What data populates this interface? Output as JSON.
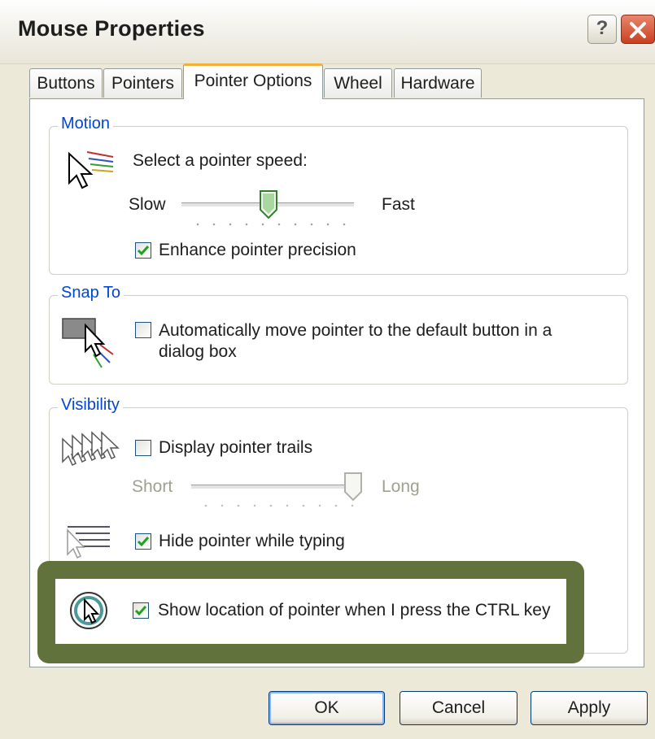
{
  "window": {
    "title": "Mouse Properties",
    "help_label": "?",
    "close_icon": "close-icon"
  },
  "tabs": [
    {
      "label": "Buttons"
    },
    {
      "label": "Pointers"
    },
    {
      "label": "Pointer Options",
      "active": true
    },
    {
      "label": "Wheel"
    },
    {
      "label": "Hardware"
    }
  ],
  "motion": {
    "legend": "Motion",
    "speed_label": "Select a pointer speed:",
    "slow_label": "Slow",
    "fast_label": "Fast",
    "speed_level": 0.5,
    "enhance_label": "Enhance pointer precision",
    "enhance_checked": true
  },
  "snap": {
    "legend": "Snap To",
    "auto_line1": "Automatically move pointer to the default button in a",
    "auto_line2": "dialog box",
    "auto_checked": false
  },
  "visibility": {
    "legend": "Visibility",
    "trails_label": "Display pointer trails",
    "trails_checked": false,
    "short_label": "Short",
    "long_label": "Long",
    "trail_level": 1.0,
    "hide_label": "Hide pointer while typing",
    "hide_checked": true,
    "show_label": "Show location of pointer when I press the CTRL key",
    "show_checked": true
  },
  "buttons": {
    "ok": "OK",
    "cancel": "Cancel",
    "apply": "Apply"
  },
  "colors": {
    "highlight": "#61723d",
    "legend": "#0046d5",
    "active_tab_accent": "#f2b03a"
  }
}
